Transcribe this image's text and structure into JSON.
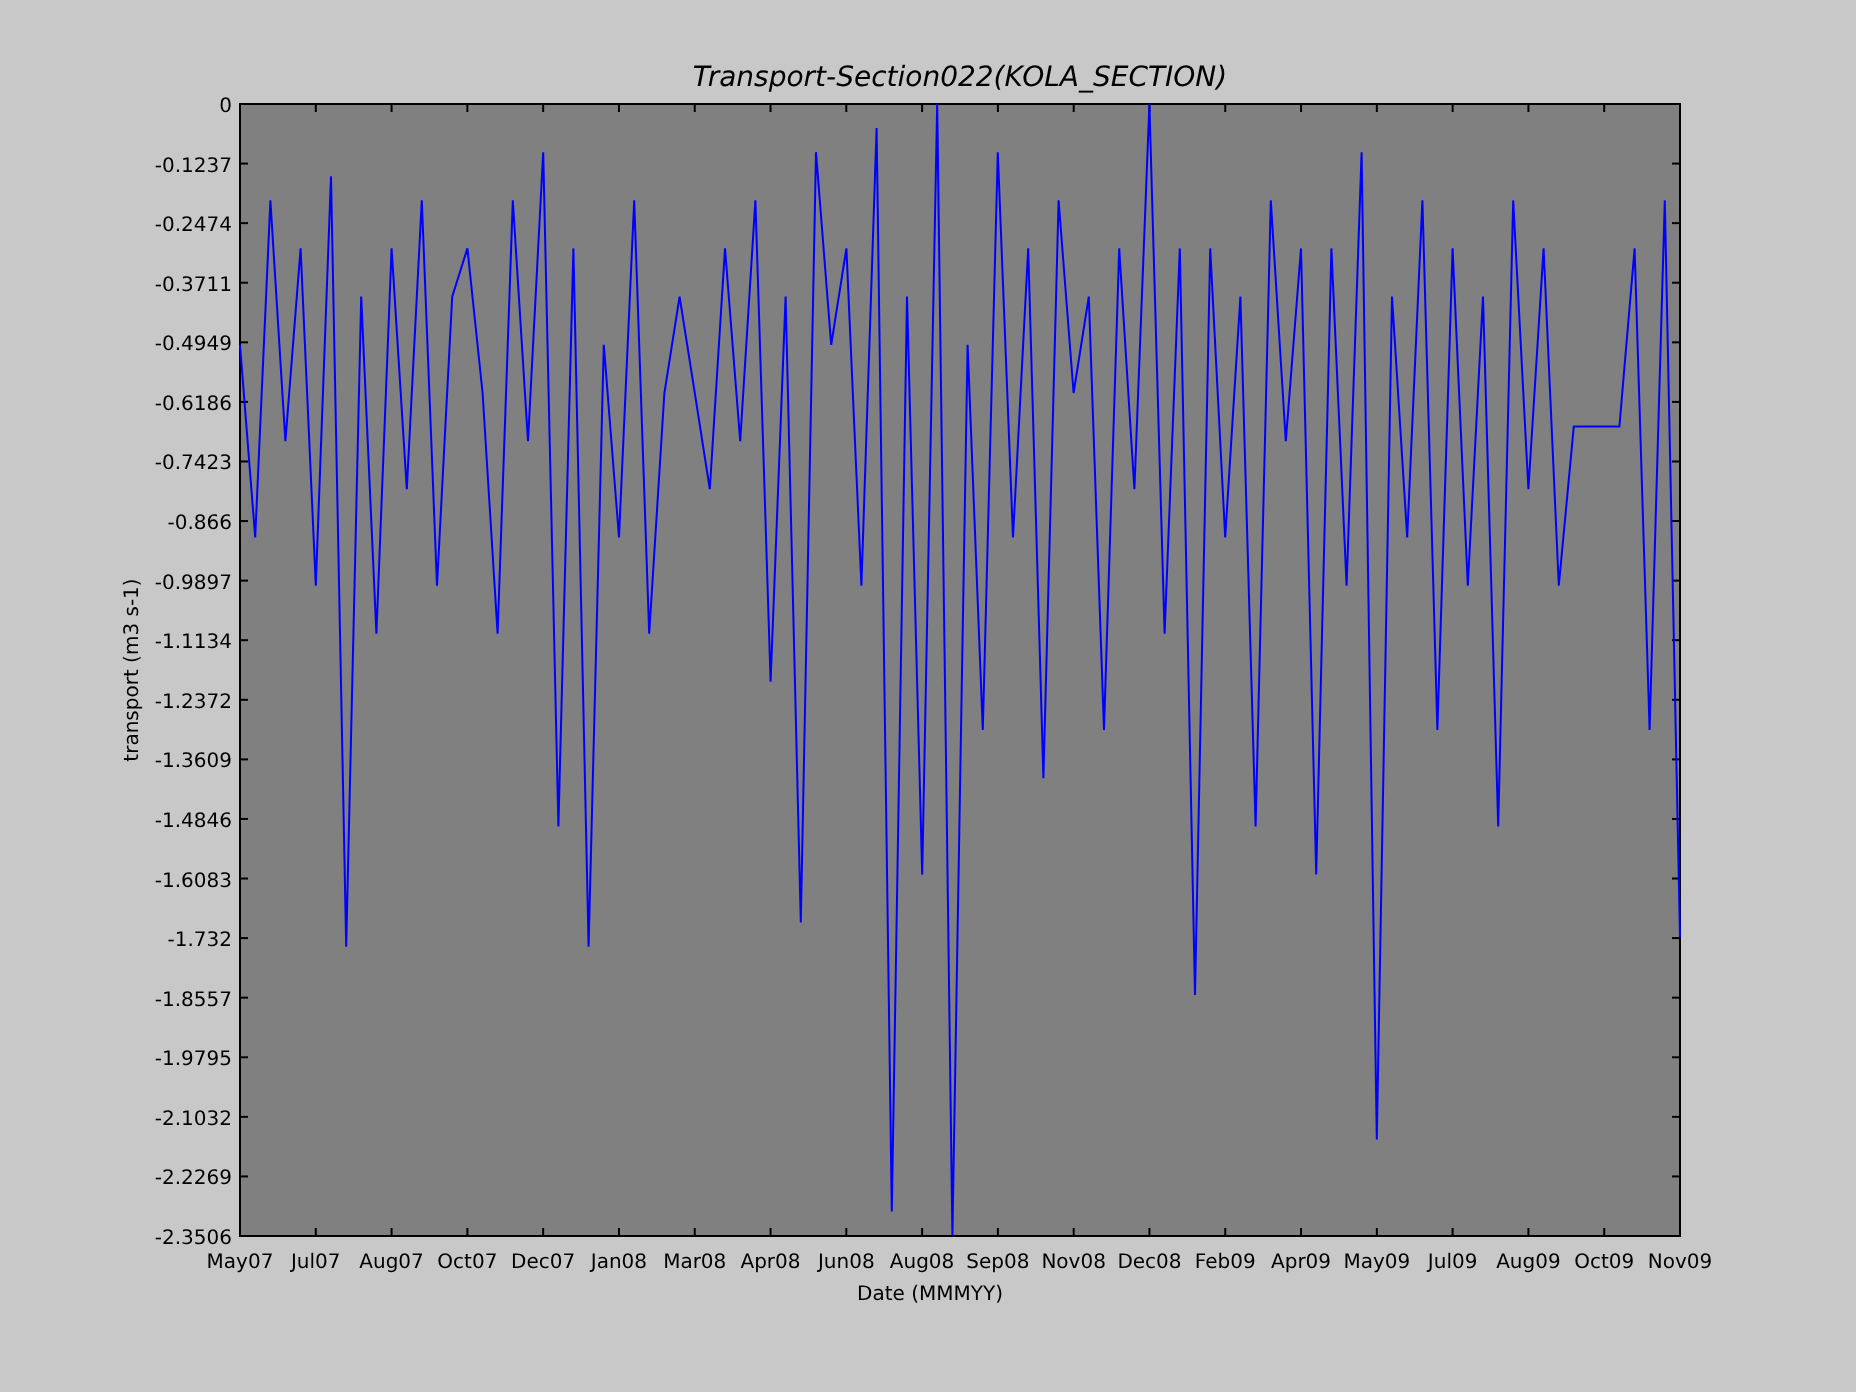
{
  "chart_data": {
    "type": "line",
    "title": "Transport-Section022(KOLA_SECTION)",
    "xlabel": "Date (MMMYY)",
    "ylabel": "transport (m3 s-1)",
    "ylim": [
      -2.3506,
      0
    ],
    "categories": [
      "May07",
      null,
      null,
      null,
      null,
      "Jul07",
      null,
      null,
      null,
      null,
      "Aug07",
      null,
      null,
      null,
      null,
      "Oct07",
      null,
      null,
      null,
      null,
      "Dec07",
      null,
      null,
      null,
      null,
      "Jan08",
      null,
      null,
      null,
      null,
      "Mar08",
      null,
      null,
      null,
      null,
      "Apr08",
      null,
      null,
      null,
      null,
      "Jun08",
      null,
      null,
      null,
      null,
      "Aug08",
      null,
      null,
      null,
      null,
      "Sep08",
      null,
      null,
      null,
      null,
      "Nov08",
      null,
      null,
      null,
      null,
      "Dec08",
      null,
      null,
      null,
      null,
      "Feb09",
      null,
      null,
      null,
      null,
      "Apr09",
      null,
      null,
      null,
      null,
      "May09",
      null,
      null,
      null,
      null,
      "Jul09",
      null,
      null,
      null,
      null,
      "Aug09",
      null,
      null,
      null,
      null,
      "Oct09",
      null,
      null,
      null,
      null,
      "Nov09"
    ],
    "yticks": [
      {
        "value": 0,
        "label": "0"
      },
      {
        "value": -0.1237,
        "label": "-0.1237"
      },
      {
        "value": -0.2474,
        "label": "-0.2474"
      },
      {
        "value": -0.3711,
        "label": "-0.3711"
      },
      {
        "value": -0.4949,
        "label": "-0.4949"
      },
      {
        "value": -0.6186,
        "label": "-0.6186"
      },
      {
        "value": -0.7423,
        "label": "-0.7423"
      },
      {
        "value": -0.866,
        "label": "-0.866"
      },
      {
        "value": -0.9897,
        "label": "-0.9897"
      },
      {
        "value": -1.1134,
        "label": "-1.1134"
      },
      {
        "value": -1.2372,
        "label": "-1.2372"
      },
      {
        "value": -1.3609,
        "label": "-1.3609"
      },
      {
        "value": -1.4846,
        "label": "-1.4846"
      },
      {
        "value": -1.6083,
        "label": "-1.6083"
      },
      {
        "value": -1.732,
        "label": "-1.732"
      },
      {
        "value": -1.8557,
        "label": "-1.8557"
      },
      {
        "value": -1.9795,
        "label": "-1.9795"
      },
      {
        "value": -2.1032,
        "label": "-2.1032"
      },
      {
        "value": -2.2269,
        "label": "-2.2269"
      },
      {
        "value": -2.3506,
        "label": "-2.3506"
      }
    ],
    "series": [
      {
        "color": "#0000ff",
        "values": [
          -0.5,
          -0.9,
          -0.2,
          -0.7,
          -0.3,
          -1.0,
          -0.15,
          -1.75,
          -0.4,
          -1.1,
          -0.3,
          -0.8,
          -0.2,
          -1.0,
          -0.4,
          -0.3,
          -0.6,
          -1.1,
          -0.2,
          -0.7,
          -0.1,
          -1.5,
          -0.3,
          -1.75,
          -0.5,
          -0.9,
          -0.2,
          -1.1,
          -0.6,
          -0.4,
          -0.6,
          -0.8,
          -0.3,
          -0.7,
          -0.2,
          -1.2,
          -0.4,
          -1.7,
          -0.1,
          -0.5,
          -0.3,
          -1.0,
          -0.05,
          -2.3,
          -0.4,
          -1.6,
          0,
          -2.35,
          -0.5,
          -1.3,
          -0.1,
          -0.9,
          -0.3,
          -1.4,
          -0.2,
          -0.6,
          -0.4,
          -1.3,
          -0.3,
          -0.8,
          0,
          -1.1,
          -0.3,
          -1.85,
          -0.3,
          -0.9,
          -0.4,
          -1.5,
          -0.2,
          -0.7,
          -0.3,
          -1.6,
          -0.3,
          -1.0,
          -0.1,
          -2.15,
          -0.4,
          -0.9,
          -0.2,
          -1.3,
          -0.3,
          -1.0,
          -0.4,
          -1.5,
          -0.2,
          -0.8,
          -0.3,
          -1.0,
          -0.67,
          -0.67,
          -0.67,
          -0.67,
          -0.3,
          -1.3,
          -0.2,
          -1.73
        ]
      }
    ]
  }
}
